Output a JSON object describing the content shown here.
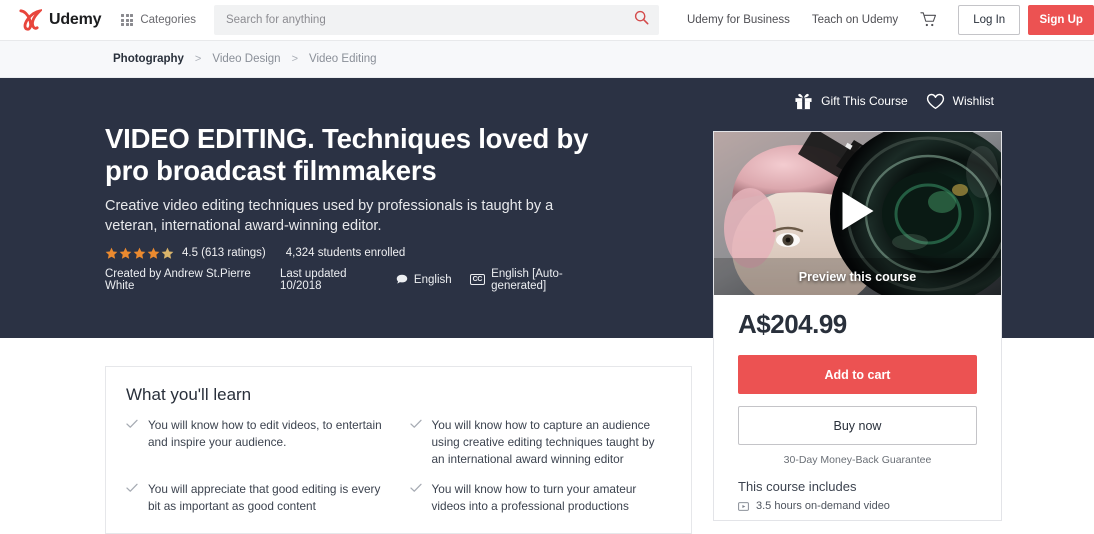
{
  "header": {
    "logo_text": "Udemy",
    "logo_icon": "udemy-logo-icon",
    "categories_label": "Categories",
    "categories_icon": "grid-dots-icon",
    "search_placeholder": "Search for anything",
    "search_value": "",
    "search_icon": "search-icon",
    "nav": [
      {
        "label": "Udemy for Business"
      },
      {
        "label": "Teach on Udemy"
      }
    ],
    "cart_icon": "shopping-cart-icon",
    "login_label": "Log In",
    "signup_label": "Sign Up"
  },
  "breadcrumb": {
    "items": [
      {
        "label": "Photography"
      },
      {
        "label": "Video Design"
      },
      {
        "label": "Video Editing"
      }
    ],
    "separator": ">"
  },
  "hero": {
    "gift_label": "Gift This Course",
    "gift_icon": "gift-icon",
    "wishlist_label": "Wishlist",
    "wishlist_icon": "heart-icon",
    "title": "VIDEO EDITING. Techniques loved by pro broadcast filmmakers",
    "subtitle": "Creative video editing techniques used by professionals is taught by a veteran, international award-winning editor.",
    "rating_value": "4.5",
    "rating_text": "4.5 (613 ratings)",
    "students_text": "4,324 students enrolled",
    "stars_filled": 4,
    "stars_half": 1,
    "created_by": "Created by Andrew St.Pierre White",
    "last_updated": "Last updated 10/2018",
    "language": "English",
    "language_icon": "speech-bubble-icon",
    "captions": "English [Auto-generated]",
    "captions_icon": "closed-caption-icon",
    "background_color": "#2b3244"
  },
  "sidebar": {
    "preview_label": "Preview this course",
    "play_icon": "play-triangle-icon",
    "price": "A$204.99",
    "add_to_cart_label": "Add to cart",
    "buy_now_label": "Buy now",
    "guarantee": "30-Day Money-Back Guarantee",
    "includes_title": "This course includes",
    "includes": [
      {
        "icon": "video-icon",
        "label": "3.5 hours on-demand video"
      }
    ],
    "accent_color": "#ec5252"
  },
  "learn": {
    "title": "What you'll learn",
    "check_icon": "check-icon",
    "items": [
      {
        "text": "You will know how to edit videos, to entertain and inspire your audience."
      },
      {
        "text": "You will know how to capture an audience using creative editing techniques taught by an international award winning editor"
      },
      {
        "text": "You will appreciate that good editing is every bit as important as good content"
      },
      {
        "text": "You will know how to turn your amateur videos into a professional productions"
      }
    ]
  }
}
